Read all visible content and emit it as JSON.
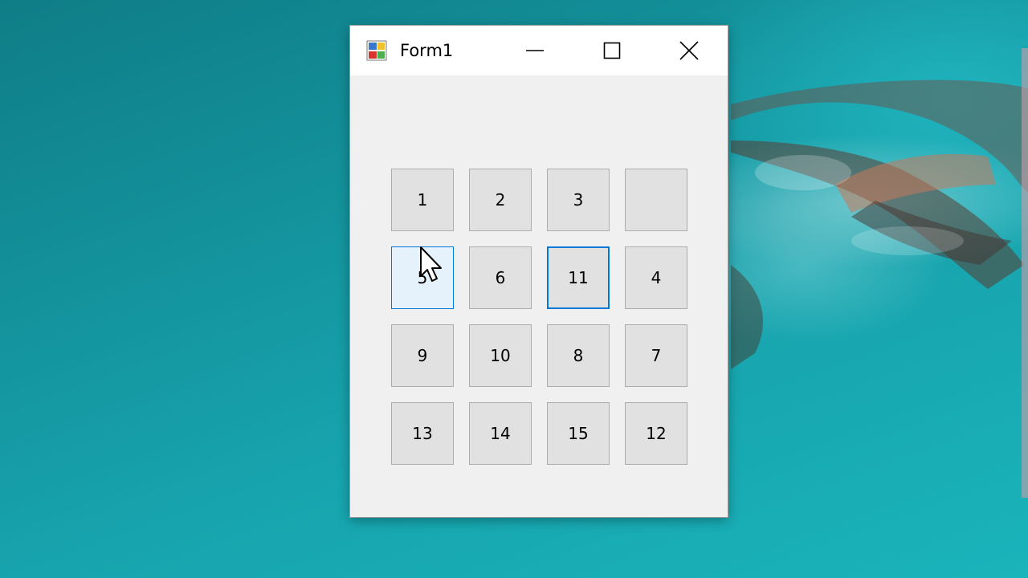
{
  "window": {
    "title": "Form1",
    "controls": {
      "minimize": "minimize",
      "maximize": "maximize",
      "close": "close"
    }
  },
  "puzzle": {
    "rows": [
      [
        "1",
        "2",
        "3",
        ""
      ],
      [
        "5",
        "6",
        "11",
        "4"
      ],
      [
        "9",
        "10",
        "8",
        "7"
      ],
      [
        "13",
        "14",
        "15",
        "12"
      ]
    ],
    "hovered_tile": "5",
    "focused_tile": "11"
  },
  "colors": {
    "accent": "#0078d7",
    "tile_face": "#e1e1e1",
    "tile_border": "#adadad",
    "window_bg": "#f0f0f0"
  },
  "icons": {
    "app": "winforms-app-icon",
    "cursor": "arrow-cursor-icon"
  }
}
